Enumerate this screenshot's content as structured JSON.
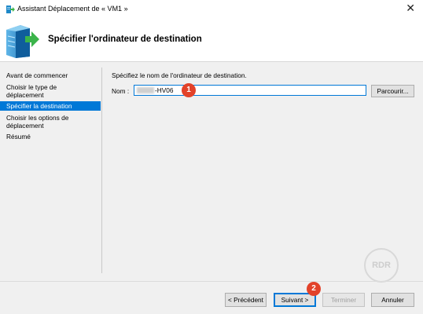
{
  "window": {
    "title": "Assistant Déplacement de « VM1 »",
    "close_glyph": "✕"
  },
  "header": {
    "title": "Spécifier l'ordinateur de destination",
    "icon": "server-arrow-icon"
  },
  "sidebar": {
    "items": [
      {
        "label": "Avant de commencer",
        "active": false
      },
      {
        "label": "Choisir le type de déplacement",
        "active": false
      },
      {
        "label": "Spécifier la destination",
        "active": true
      },
      {
        "label": "Choisir les options de déplacement",
        "active": false
      },
      {
        "label": "Résumé",
        "active": false
      }
    ]
  },
  "main": {
    "description": "Spécifiez le nom de l'ordinateur de destination.",
    "name_label": "Nom :",
    "name_value": "-HV06",
    "browse_label": "Parcourir..."
  },
  "badges": {
    "one": "1",
    "two": "2"
  },
  "watermark": "RDR",
  "footer": {
    "previous": "< Précédent",
    "next": "Suivant >",
    "finish": "Terminer",
    "cancel": "Annuler"
  },
  "colors": {
    "accent": "#0078d7",
    "badge": "#e2422a"
  }
}
